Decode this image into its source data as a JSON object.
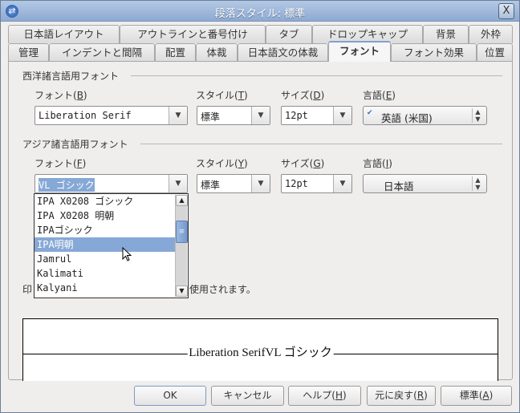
{
  "window": {
    "title": "段落スタイル: 標準",
    "close": "X"
  },
  "tabs_row1": [
    "日本語レイアウト",
    "アウトラインと番号付け",
    "タブ",
    "ドロップキャップ",
    "背景",
    "外枠"
  ],
  "tabs_row2": [
    "管理",
    "インデントと間隔",
    "配置",
    "体裁",
    "日本語文の体裁",
    "フォント",
    "フォント効果",
    "位置"
  ],
  "active_tab": "フォント",
  "western": {
    "section": "西洋諸言語用フォント",
    "font_label": "フォント(",
    "font_key": "B",
    "style_label": "スタイル(",
    "style_key": "T",
    "size_label": "サイズ(",
    "size_key": "D",
    "lang_label": "言語(",
    "lang_key": "E",
    "close": ")",
    "font": "Liberation Serif",
    "style": "標準",
    "size": "12pt",
    "language": "英語 (米国)"
  },
  "asian": {
    "section": "アジア諸言語用フォント",
    "font_label": "フォント(",
    "font_key": "F",
    "style_label": "スタイル(",
    "style_key": "Y",
    "size_label": "サイズ(",
    "size_key": "G",
    "lang_label": "言語(",
    "lang_key": "I",
    "close": ")",
    "font": "VL ゴシック",
    "style": "標準",
    "size": "12pt",
    "language": "日本語"
  },
  "dropdown": {
    "items": [
      "IPA X0208 ゴシック",
      "IPA X0208 明朝",
      "IPAゴシック",
      "IPA明朝",
      "Jamrul",
      "Kalimati",
      "Kalyani"
    ],
    "highlighted": "IPA明朝"
  },
  "note": {
    "prefix": "印",
    "suffix": "使用されます。"
  },
  "preview": {
    "text": "Liberation SerifVL ゴシック"
  },
  "buttons": {
    "ok": "OK",
    "cancel": "キャンセル",
    "help": "ヘルプ(",
    "help_key": "H",
    "reset": "元に戻す(",
    "reset_key": "R",
    "standard": "標準(",
    "standard_key": "A",
    "close": ")"
  }
}
